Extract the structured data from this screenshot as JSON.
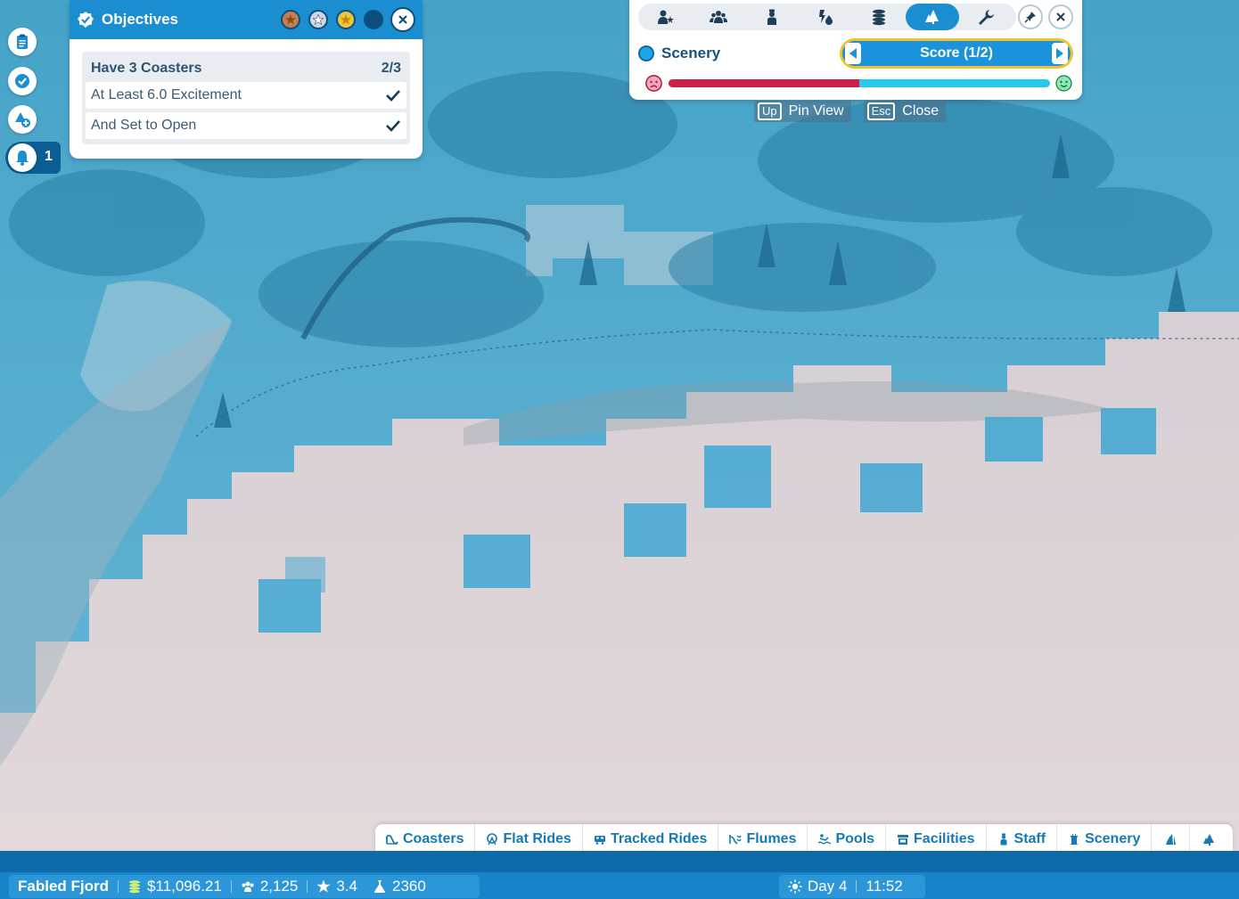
{
  "objectives": {
    "title": "Objectives",
    "close_icon": "close-icon",
    "main": {
      "label": "Have 3 Coasters",
      "progress": "2/3"
    },
    "sub": [
      {
        "label": "At Least 6.0 Excitement"
      },
      {
        "label": "And Set to Open"
      }
    ]
  },
  "overlay": {
    "tabs": [
      "guest-thoughts-icon",
      "guests-icon",
      "staff-icon",
      "hygiene-icon",
      "finance-icon",
      "scenery-icon",
      "maintenance-icon"
    ],
    "active_tab": 5,
    "label": "Scenery",
    "score_label": "Score (1/2)",
    "scale_bad_fraction": 0.5,
    "colors": {
      "bad": "#d01f45",
      "good": "#25c8ef",
      "accent": "#1a8ed0",
      "selector_border": "#f1c12a"
    }
  },
  "hints": [
    {
      "key": "Up",
      "label": "Pin View"
    },
    {
      "key": "Esc",
      "label": "Close"
    }
  ],
  "notifications": {
    "count": "1"
  },
  "build_bar": {
    "tabs": [
      {
        "label": "Coasters"
      },
      {
        "label": "Flat Rides"
      },
      {
        "label": "Tracked Rides"
      },
      {
        "label": "Flumes"
      },
      {
        "label": "Pools"
      },
      {
        "label": "Facilities"
      },
      {
        "label": "Staff"
      },
      {
        "label": "Scenery"
      }
    ]
  },
  "status": {
    "park_name": "Fabled Fjord",
    "money": "$11,096.21",
    "guests": "2,125",
    "rating": "3.4",
    "research": "2360",
    "day": "Day 4",
    "time": "11:52"
  }
}
